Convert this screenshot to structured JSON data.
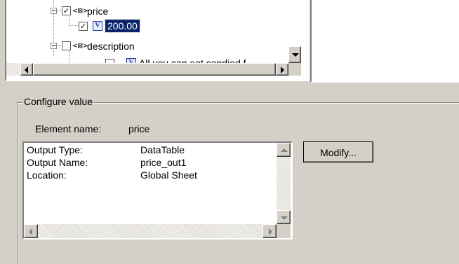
{
  "tree": {
    "nodes": [
      {
        "label": "price",
        "checked": true,
        "type": "element",
        "check_glyph": "✓"
      },
      {
        "label": "200.00",
        "checked": true,
        "type": "value",
        "selected": true,
        "check_glyph": "✓",
        "value_glyph": "V"
      },
      {
        "label": "description",
        "checked": false,
        "type": "element"
      },
      {
        "label": "All you can eat candied f",
        "checked": false,
        "type": "value",
        "value_glyph": "V"
      }
    ],
    "element_glyph": "<⊠>"
  },
  "configure": {
    "group_label": "Configure value",
    "element_name_label": "Element name:",
    "element_name_value": "price",
    "details": [
      {
        "key": "Output Type:",
        "value": "DataTable"
      },
      {
        "key": "Output Name:",
        "value": "price_out1"
      },
      {
        "key": "Location:",
        "value": "Global Sheet"
      }
    ],
    "modify_label": "Modify..."
  },
  "colors": {
    "face": "#d4d0c8",
    "selection": "#0a246a",
    "window": "#ffffff"
  }
}
